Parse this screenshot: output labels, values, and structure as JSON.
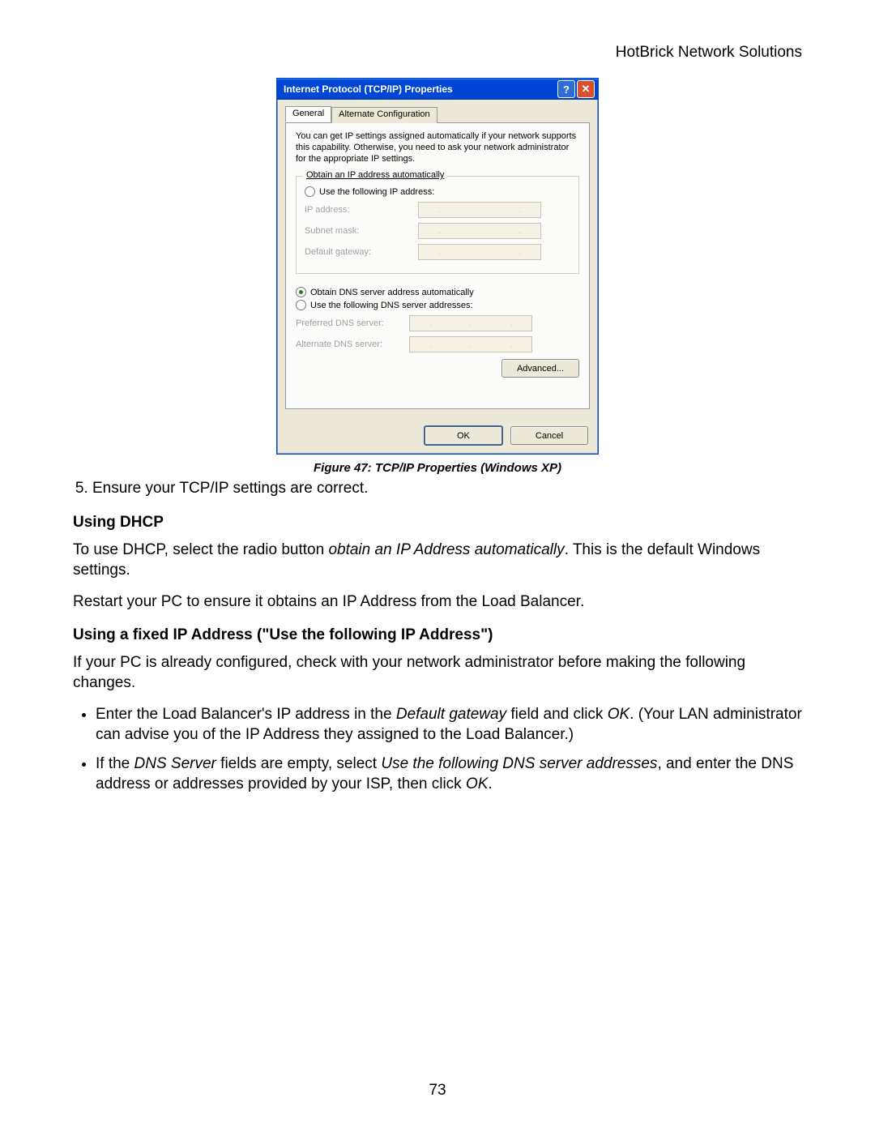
{
  "doc": {
    "header": "HotBrick Network Solutions",
    "page_number": "73",
    "figure_caption": "Figure 47: TCP/IP Properties (Windows XP)",
    "step5": "Ensure your TCP/IP settings are correct.",
    "sec_dhcp_title": "Using DHCP",
    "sec_dhcp_p1a": "To use DHCP, select the radio button ",
    "sec_dhcp_p1b": "obtain an IP Address automatically",
    "sec_dhcp_p1c": ". This is the default Windows settings.",
    "sec_dhcp_p2": "Restart your PC to ensure it obtains an IP Address from the Load Balancer.",
    "sec_fixed_title": "Using a fixed IP Address (\"Use the following IP Address\")",
    "sec_fixed_p1": "If your PC is already configured, check with your network administrator before making the following changes.",
    "bullet1a": "Enter the Load Balancer's IP address in the ",
    "bullet1b": "Default gateway",
    "bullet1c": " field and click ",
    "bullet1d": "OK",
    "bullet1e": ". (Your LAN administrator can advise you of the IP Address they assigned to the Load Balancer.)",
    "bullet2a": "If the ",
    "bullet2b": "DNS Server",
    "bullet2c": " fields are empty, select ",
    "bullet2d": "Use the following DNS server addresses",
    "bullet2e": ", and enter the DNS address or addresses provided by your ISP, then click ",
    "bullet2f": "OK",
    "bullet2g": "."
  },
  "win": {
    "title": "Internet Protocol (TCP/IP) Properties",
    "tab_general": "General",
    "tab_alt": "Alternate Configuration",
    "intro": "You can get IP settings assigned automatically if your network supports this capability. Otherwise, you need to ask your network administrator for the appropriate IP settings.",
    "opt_auto_ip": "Obtain an IP address automatically",
    "opt_use_ip": "Use the following IP address:",
    "lbl_ip": "IP address:",
    "lbl_subnet": "Subnet mask:",
    "lbl_gateway": "Default gateway:",
    "opt_auto_dns": "Obtain DNS server address automatically",
    "opt_use_dns": "Use the following DNS server addresses:",
    "lbl_pref_dns": "Preferred DNS server:",
    "lbl_alt_dns": "Alternate DNS server:",
    "btn_advanced": "Advanced...",
    "btn_ok": "OK",
    "btn_cancel": "Cancel"
  }
}
